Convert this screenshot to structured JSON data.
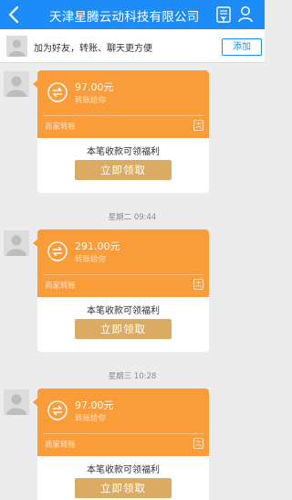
{
  "nav": {
    "title": "天津星腾云动科技有限公司"
  },
  "add_friend": {
    "text": "加为好友，转账、聊天更方便",
    "button": "添加"
  },
  "messages": [
    {
      "amount": "97.00元",
      "sub": "转账给你",
      "type": "商家转账",
      "benefit": "本笔收款可领福利",
      "button": "立即领取"
    },
    {
      "time": "星期二 09:44",
      "amount": "291.00元",
      "sub": "转账给你",
      "type": "商家转账",
      "benefit": "本笔收款可领福利",
      "button": "立即领取"
    },
    {
      "time": "星期三 10:28",
      "amount": "97.00元",
      "sub": "转账给你",
      "type": "商家转账",
      "benefit": "本笔收款可领福利",
      "button": "立即领取"
    }
  ],
  "colors": {
    "nav": "#1d8cf8",
    "card_orange": "#fb9c3b",
    "claim_button": "#d9ab63",
    "chat_background": "#ececec"
  }
}
